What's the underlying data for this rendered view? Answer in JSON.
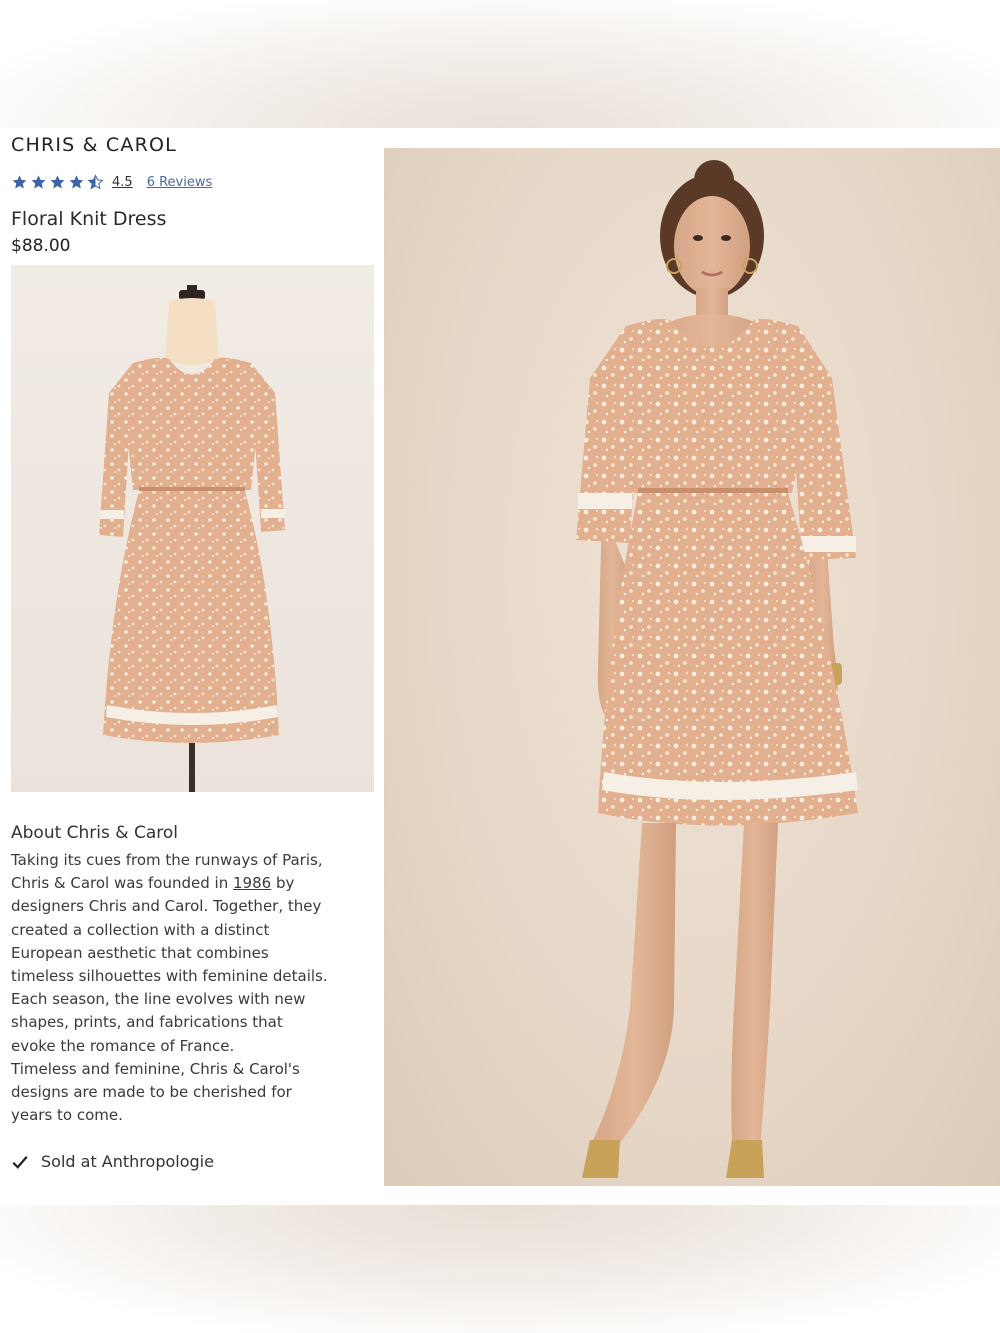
{
  "product": {
    "brand": "CHRIS & CAROL",
    "rating": "4.5",
    "reviews_link": "6 Reviews",
    "name": "Floral Knit Dress",
    "price": "$88.00"
  },
  "rating_value": 4.5,
  "rating_max": 5,
  "colors": {
    "star": "#3f64a8",
    "dress": "#e3b08f",
    "lace": "#f6efe6",
    "background": "#e6d7c7"
  },
  "about": {
    "title": "About Chris & Carol",
    "line1": "Taking its cues from the runways of Paris,",
    "line2_pre": "Chris & Carol was founded in ",
    "year": "1986",
    "line2_post": " by",
    "line3": "designers Chris and Carol. Together, they",
    "line4": "created a collection with a distinct",
    "line5": "European aesthetic that combines",
    "line6": "timeless silhouettes with feminine details.",
    "line7": "Each season, the line evolves with new",
    "line8": "shapes, prints, and fabrications that",
    "line9": "evoke the romance of France.",
    "line10": "Timeless and feminine, Chris & Carol's",
    "line11": "designs are made to be cherished for",
    "line12": "years to come."
  },
  "sold_at": "Sold at Anthropologie",
  "icons": {
    "star": "star-icon",
    "half_star": "half-star-icon",
    "check": "check-icon"
  }
}
